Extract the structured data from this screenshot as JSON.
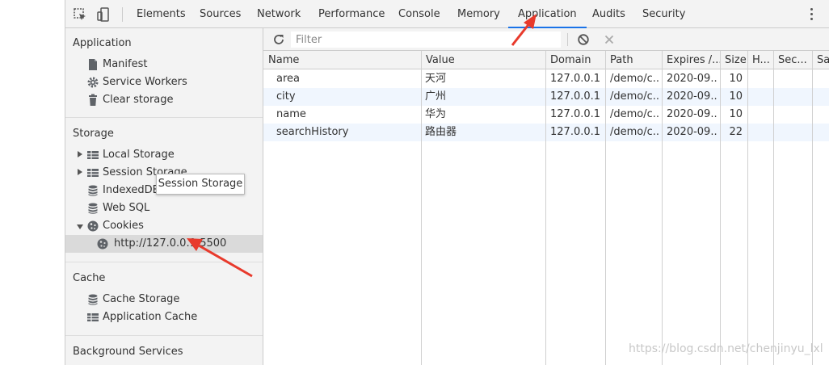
{
  "toolbar": {
    "tabs": [
      "Elements",
      "Sources",
      "Network",
      "Performance",
      "Console",
      "Memory",
      "Application",
      "Audits",
      "Security"
    ],
    "active_tab": "Application"
  },
  "sidebar": {
    "application": {
      "title": "Application",
      "items": [
        "Manifest",
        "Service Workers",
        "Clear storage"
      ]
    },
    "storage": {
      "title": "Storage",
      "items": [
        "Local Storage",
        "Session Storage",
        "IndexedDB",
        "Web SQL",
        "Cookies"
      ],
      "cookie_origin": "http://127.0.0.1:5500"
    },
    "cache": {
      "title": "Cache",
      "items": [
        "Cache Storage",
        "Application Cache"
      ]
    },
    "background": {
      "title": "Background Services"
    }
  },
  "tooltip": "Session Storage",
  "filter": {
    "placeholder": "Filter"
  },
  "table": {
    "columns": [
      "Name",
      "Value",
      "Domain",
      "Path",
      "Expires /...",
      "Size",
      "H...",
      "Sec...",
      "Sa"
    ],
    "rows": [
      {
        "name": "area",
        "value": "天河",
        "domain": "127.0.0.1",
        "path": "/demo/c...",
        "expires": "2020-09...",
        "size": "10"
      },
      {
        "name": "city",
        "value": "广州",
        "domain": "127.0.0.1",
        "path": "/demo/c...",
        "expires": "2020-09...",
        "size": "10"
      },
      {
        "name": "name",
        "value": "华为",
        "domain": "127.0.0.1",
        "path": "/demo/c...",
        "expires": "2020-09...",
        "size": "10"
      },
      {
        "name": "searchHistory",
        "value": "路由器",
        "domain": "127.0.0.1",
        "path": "/demo/c...",
        "expires": "2020-09...",
        "size": "22"
      }
    ]
  },
  "watermark": "https://blog.csdn.net/chenjinyu_lxl",
  "colors": {
    "accent": "#1a73e8",
    "annotation_arrow": "#e83a2c",
    "selected_row": "#dadada",
    "alt_row": "#f0f6fe"
  }
}
